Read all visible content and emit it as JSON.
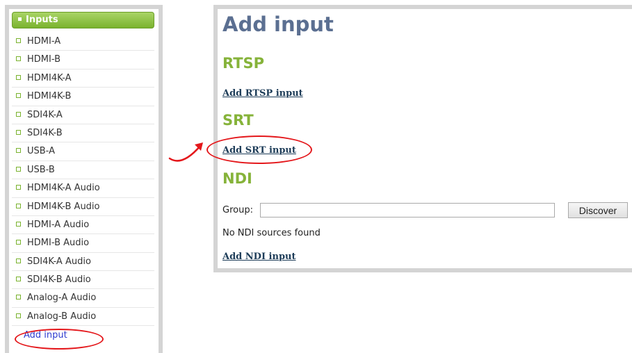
{
  "sidebar": {
    "header": "Inputs",
    "items": [
      {
        "label": "HDMI-A"
      },
      {
        "label": "HDMI-B"
      },
      {
        "label": "HDMI4K-A"
      },
      {
        "label": "HDMI4K-B"
      },
      {
        "label": "SDI4K-A"
      },
      {
        "label": "SDI4K-B"
      },
      {
        "label": "USB-A"
      },
      {
        "label": "USB-B"
      },
      {
        "label": "HDMI4K-A Audio"
      },
      {
        "label": "HDMI4K-B Audio"
      },
      {
        "label": "HDMI-A Audio"
      },
      {
        "label": "HDMI-B Audio"
      },
      {
        "label": "SDI4K-A Audio"
      },
      {
        "label": "SDI4K-B Audio"
      },
      {
        "label": "Analog-A Audio"
      },
      {
        "label": "Analog-B Audio"
      }
    ],
    "add_input": "Add input"
  },
  "main": {
    "title": "Add input",
    "rtsp": {
      "heading": "RTSP",
      "link": "Add RTSP input"
    },
    "srt": {
      "heading": "SRT",
      "link": "Add SRT input"
    },
    "ndi": {
      "heading": "NDI",
      "group_label": "Group:",
      "group_value": "",
      "discover_label": "Discover",
      "status": "No NDI sources found",
      "link": "Add NDI input"
    }
  },
  "colors": {
    "accent_green": "#86b33a",
    "title_blue": "#5b6f91",
    "link_navy": "#1d3c58",
    "annotation_red": "#e4171b"
  }
}
